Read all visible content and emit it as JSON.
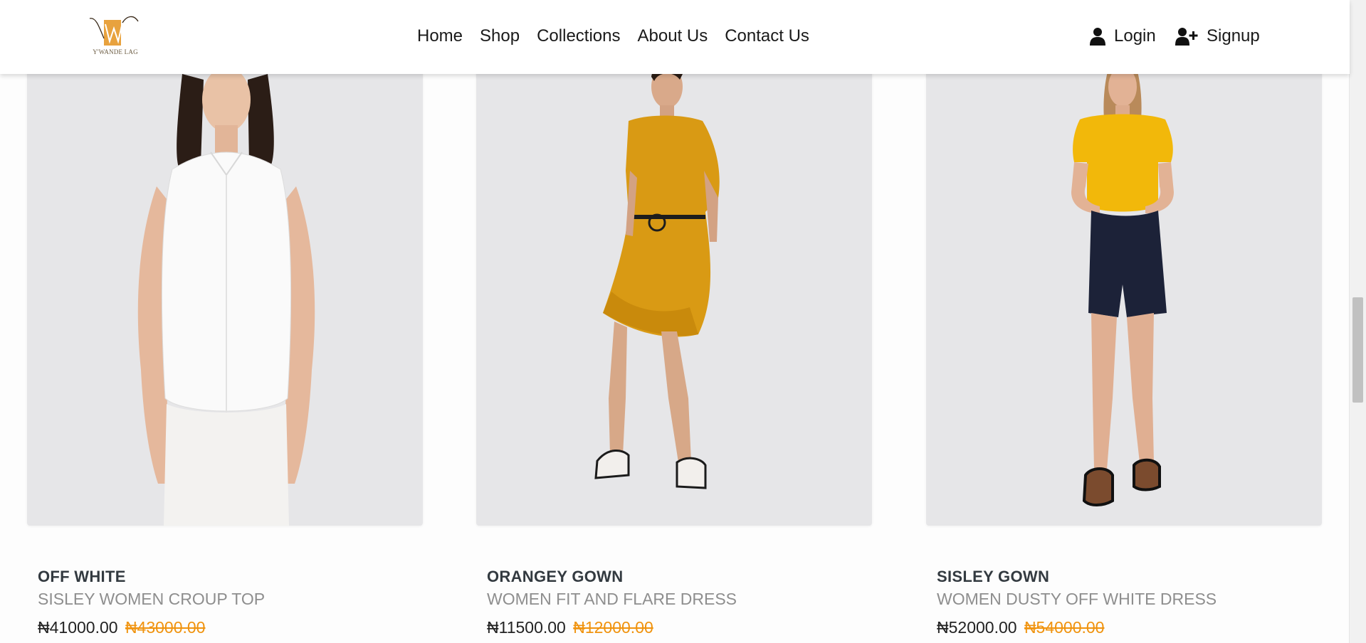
{
  "header": {
    "brand_text": "Y'WANDE LAG",
    "nav": [
      {
        "label": "Home"
      },
      {
        "label": "Shop"
      },
      {
        "label": "Collections"
      },
      {
        "label": "About Us"
      },
      {
        "label": "Contact Us"
      }
    ],
    "login_label": "Login",
    "signup_label": "Signup",
    "icons": {
      "login": "user-icon",
      "signup": "user-plus-icon"
    }
  },
  "products": [
    {
      "title": "OFF WHITE",
      "subtitle": "SISLEY WOMEN CROUP TOP",
      "price": "₦41000.00",
      "old_price": "₦43000.00"
    },
    {
      "title": "ORANGEY GOWN",
      "subtitle": "WOMEN FIT AND FLARE DRESS",
      "price": "₦11500.00",
      "old_price": "₦12000.00"
    },
    {
      "title": "SISLEY GOWN",
      "subtitle": "WOMEN DUSTY OFF WHITE DRESS",
      "price": "₦52000.00",
      "old_price": "₦54000.00"
    }
  ],
  "colors": {
    "accent_old_price": "#f0930e",
    "brand_gold": "#e8a23e",
    "photo_bg": "#e6e6e8"
  }
}
